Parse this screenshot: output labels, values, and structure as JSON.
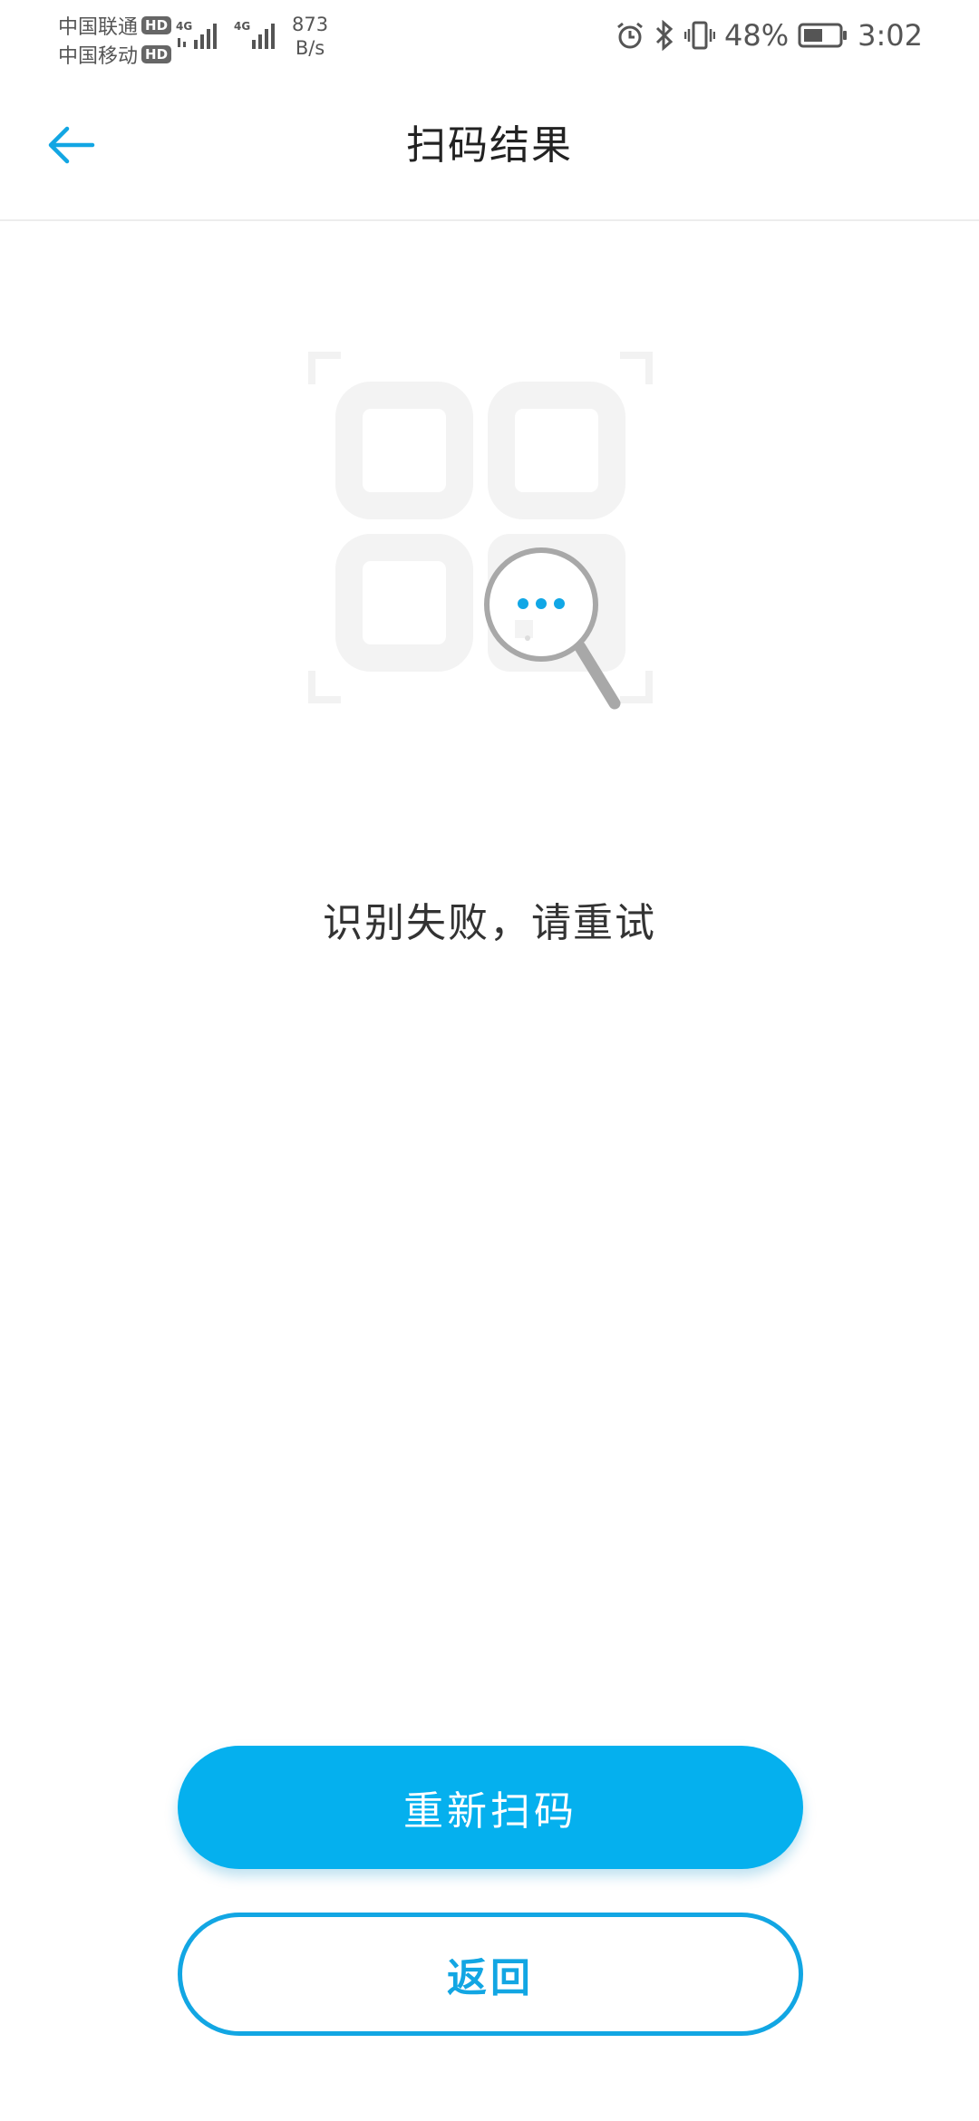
{
  "status_bar": {
    "carrier_1": "中国联通",
    "carrier_2": "中国移动",
    "hd_label": "HD",
    "network_type": "4G",
    "net_speed_value": "873",
    "net_speed_unit": "B/s",
    "battery_percent": "48%",
    "time": "3:02",
    "icons": [
      "alarm-icon",
      "bluetooth-icon",
      "vibrate-icon",
      "battery-icon"
    ]
  },
  "header": {
    "title": "扫码结果",
    "back_icon": "arrow-left-icon"
  },
  "illustration": {
    "icon": "qr-code-search-icon"
  },
  "result": {
    "message": "识别失败，请重试"
  },
  "actions": {
    "rescan_label": "重新扫码",
    "back_label": "返回"
  },
  "colors": {
    "accent": "#05b0ee",
    "outline": "#12a6e3",
    "text": "#333333",
    "illustration_gray": "#f3f3f3"
  }
}
